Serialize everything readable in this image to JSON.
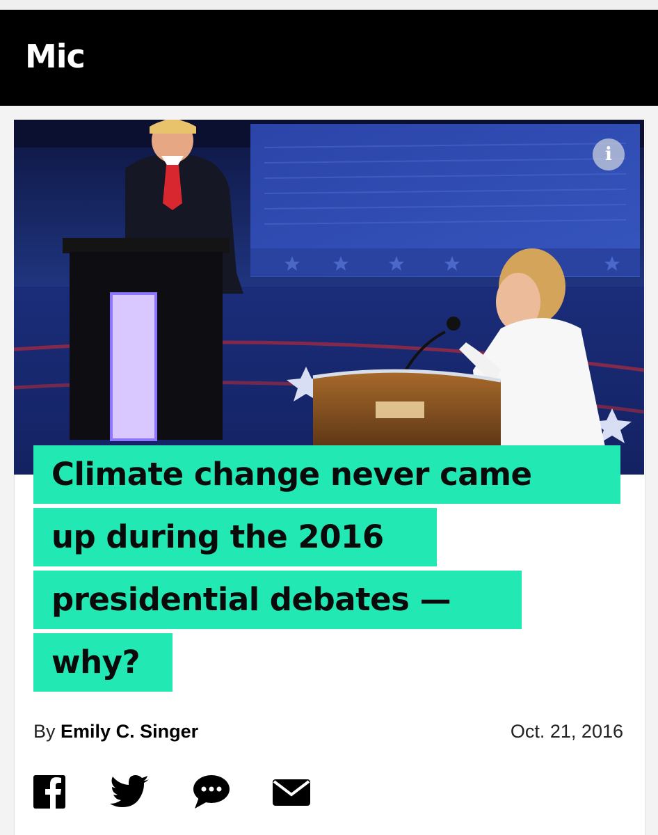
{
  "header": {
    "logo": "Mic",
    "background": "#000000"
  },
  "hero": {
    "description_icon": "info-icon",
    "info_label": "i"
  },
  "headline": {
    "lines": [
      "Climate change never came",
      "up during the 2016",
      "presidential debates —",
      "why?"
    ],
    "highlight_color": "#22e8b3"
  },
  "byline": {
    "prefix": "By",
    "author": "Emily C. Singer",
    "date": "Oct. 21, 2016"
  },
  "share": {
    "icons": [
      "facebook-icon",
      "twitter-icon",
      "comment-icon",
      "email-icon"
    ]
  }
}
